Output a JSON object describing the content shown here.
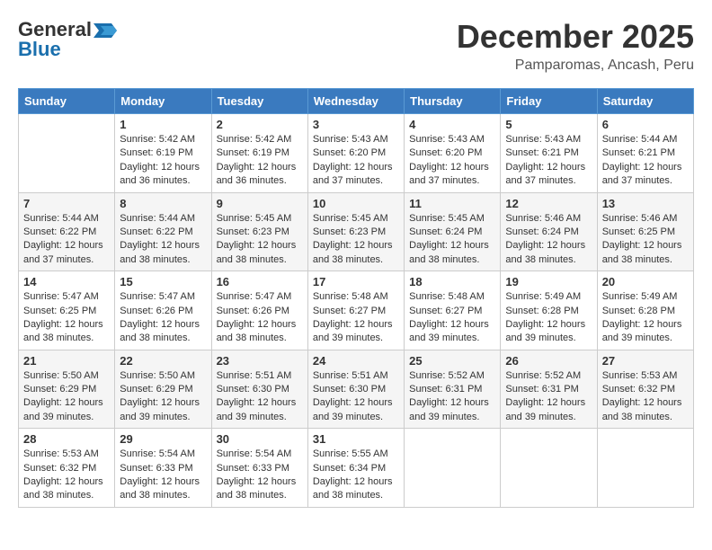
{
  "header": {
    "logo_line1": "General",
    "logo_line2": "Blue",
    "month_year": "December 2025",
    "location": "Pamparomas, Ancash, Peru"
  },
  "weekdays": [
    "Sunday",
    "Monday",
    "Tuesday",
    "Wednesday",
    "Thursday",
    "Friday",
    "Saturday"
  ],
  "weeks": [
    [
      {
        "day": "",
        "info": ""
      },
      {
        "day": "1",
        "info": "Sunrise: 5:42 AM\nSunset: 6:19 PM\nDaylight: 12 hours\nand 36 minutes."
      },
      {
        "day": "2",
        "info": "Sunrise: 5:42 AM\nSunset: 6:19 PM\nDaylight: 12 hours\nand 36 minutes."
      },
      {
        "day": "3",
        "info": "Sunrise: 5:43 AM\nSunset: 6:20 PM\nDaylight: 12 hours\nand 37 minutes."
      },
      {
        "day": "4",
        "info": "Sunrise: 5:43 AM\nSunset: 6:20 PM\nDaylight: 12 hours\nand 37 minutes."
      },
      {
        "day": "5",
        "info": "Sunrise: 5:43 AM\nSunset: 6:21 PM\nDaylight: 12 hours\nand 37 minutes."
      },
      {
        "day": "6",
        "info": "Sunrise: 5:44 AM\nSunset: 6:21 PM\nDaylight: 12 hours\nand 37 minutes."
      }
    ],
    [
      {
        "day": "7",
        "info": "Sunrise: 5:44 AM\nSunset: 6:22 PM\nDaylight: 12 hours\nand 37 minutes."
      },
      {
        "day": "8",
        "info": "Sunrise: 5:44 AM\nSunset: 6:22 PM\nDaylight: 12 hours\nand 38 minutes."
      },
      {
        "day": "9",
        "info": "Sunrise: 5:45 AM\nSunset: 6:23 PM\nDaylight: 12 hours\nand 38 minutes."
      },
      {
        "day": "10",
        "info": "Sunrise: 5:45 AM\nSunset: 6:23 PM\nDaylight: 12 hours\nand 38 minutes."
      },
      {
        "day": "11",
        "info": "Sunrise: 5:45 AM\nSunset: 6:24 PM\nDaylight: 12 hours\nand 38 minutes."
      },
      {
        "day": "12",
        "info": "Sunrise: 5:46 AM\nSunset: 6:24 PM\nDaylight: 12 hours\nand 38 minutes."
      },
      {
        "day": "13",
        "info": "Sunrise: 5:46 AM\nSunset: 6:25 PM\nDaylight: 12 hours\nand 38 minutes."
      }
    ],
    [
      {
        "day": "14",
        "info": "Sunrise: 5:47 AM\nSunset: 6:25 PM\nDaylight: 12 hours\nand 38 minutes."
      },
      {
        "day": "15",
        "info": "Sunrise: 5:47 AM\nSunset: 6:26 PM\nDaylight: 12 hours\nand 38 minutes."
      },
      {
        "day": "16",
        "info": "Sunrise: 5:47 AM\nSunset: 6:26 PM\nDaylight: 12 hours\nand 38 minutes."
      },
      {
        "day": "17",
        "info": "Sunrise: 5:48 AM\nSunset: 6:27 PM\nDaylight: 12 hours\nand 39 minutes."
      },
      {
        "day": "18",
        "info": "Sunrise: 5:48 AM\nSunset: 6:27 PM\nDaylight: 12 hours\nand 39 minutes."
      },
      {
        "day": "19",
        "info": "Sunrise: 5:49 AM\nSunset: 6:28 PM\nDaylight: 12 hours\nand 39 minutes."
      },
      {
        "day": "20",
        "info": "Sunrise: 5:49 AM\nSunset: 6:28 PM\nDaylight: 12 hours\nand 39 minutes."
      }
    ],
    [
      {
        "day": "21",
        "info": "Sunrise: 5:50 AM\nSunset: 6:29 PM\nDaylight: 12 hours\nand 39 minutes."
      },
      {
        "day": "22",
        "info": "Sunrise: 5:50 AM\nSunset: 6:29 PM\nDaylight: 12 hours\nand 39 minutes."
      },
      {
        "day": "23",
        "info": "Sunrise: 5:51 AM\nSunset: 6:30 PM\nDaylight: 12 hours\nand 39 minutes."
      },
      {
        "day": "24",
        "info": "Sunrise: 5:51 AM\nSunset: 6:30 PM\nDaylight: 12 hours\nand 39 minutes."
      },
      {
        "day": "25",
        "info": "Sunrise: 5:52 AM\nSunset: 6:31 PM\nDaylight: 12 hours\nand 39 minutes."
      },
      {
        "day": "26",
        "info": "Sunrise: 5:52 AM\nSunset: 6:31 PM\nDaylight: 12 hours\nand 39 minutes."
      },
      {
        "day": "27",
        "info": "Sunrise: 5:53 AM\nSunset: 6:32 PM\nDaylight: 12 hours\nand 38 minutes."
      }
    ],
    [
      {
        "day": "28",
        "info": "Sunrise: 5:53 AM\nSunset: 6:32 PM\nDaylight: 12 hours\nand 38 minutes."
      },
      {
        "day": "29",
        "info": "Sunrise: 5:54 AM\nSunset: 6:33 PM\nDaylight: 12 hours\nand 38 minutes."
      },
      {
        "day": "30",
        "info": "Sunrise: 5:54 AM\nSunset: 6:33 PM\nDaylight: 12 hours\nand 38 minutes."
      },
      {
        "day": "31",
        "info": "Sunrise: 5:55 AM\nSunset: 6:34 PM\nDaylight: 12 hours\nand 38 minutes."
      },
      {
        "day": "",
        "info": ""
      },
      {
        "day": "",
        "info": ""
      },
      {
        "day": "",
        "info": ""
      }
    ]
  ]
}
